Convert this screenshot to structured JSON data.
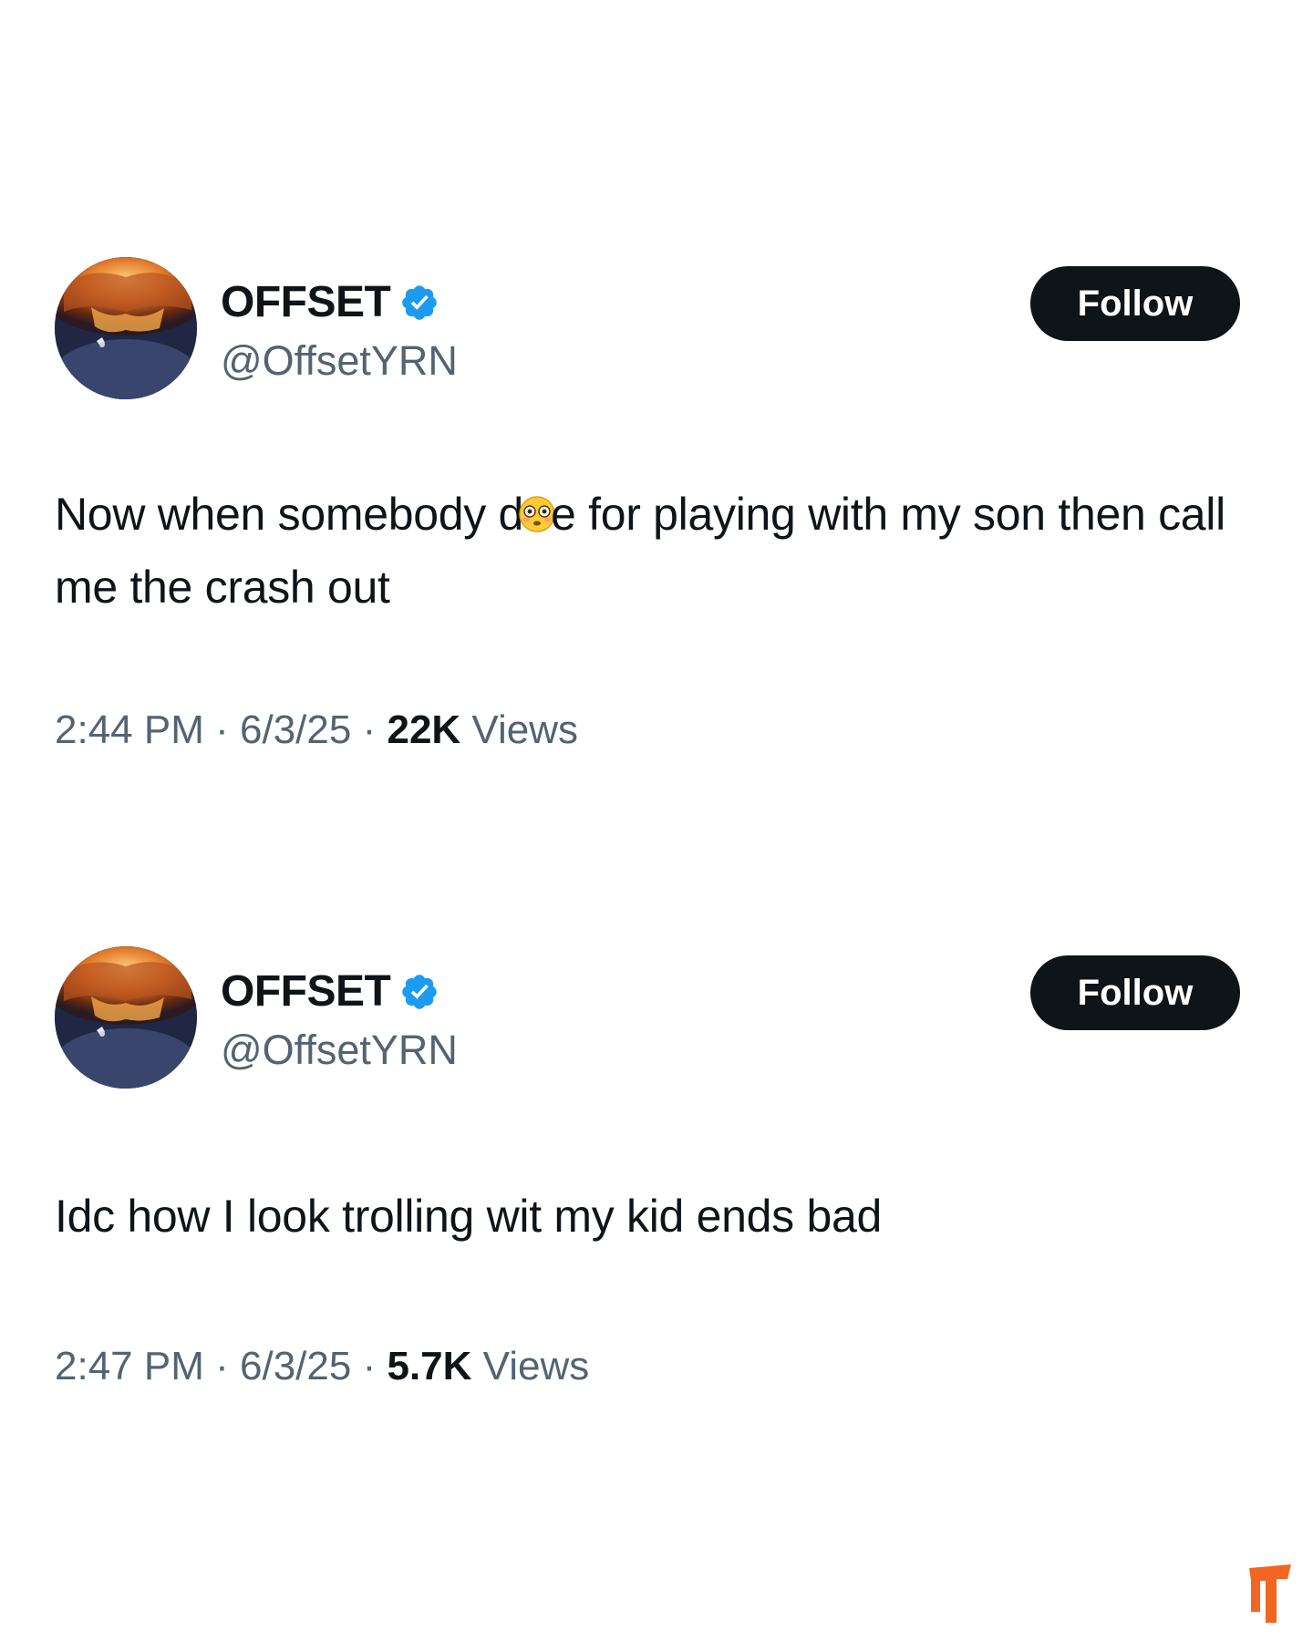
{
  "tweets": [
    {
      "author": {
        "display_name": "OFFSET",
        "handle": "@OffsetYRN",
        "verified": true,
        "avatar_icon": "avatar-image"
      },
      "follow_label": "Follow",
      "text_before_emoji": "Now when somebody d",
      "emoji": "flushed-face-emoji",
      "text_after_emoji": "e for playing with my son then call me the crash out",
      "time": "2:44 PM",
      "date": "6/3/25",
      "views_count": "22K",
      "views_label": "Views",
      "separator": "·"
    },
    {
      "author": {
        "display_name": "OFFSET",
        "handle": "@OffsetYRN",
        "verified": true,
        "avatar_icon": "avatar-image"
      },
      "follow_label": "Follow",
      "text": "Idc how I look trolling wit my kid ends bad",
      "time": "2:47 PM",
      "date": "6/3/25",
      "views_count": "5.7K",
      "views_label": "Views",
      "separator": "·"
    }
  ],
  "colors": {
    "text_primary": "#0f1419",
    "text_secondary": "#536471",
    "verified_blue": "#1d9bf0",
    "button_bg": "#0f1419",
    "watermark": "#f26522"
  },
  "watermark": {
    "icon": "brand-logo-icon"
  }
}
